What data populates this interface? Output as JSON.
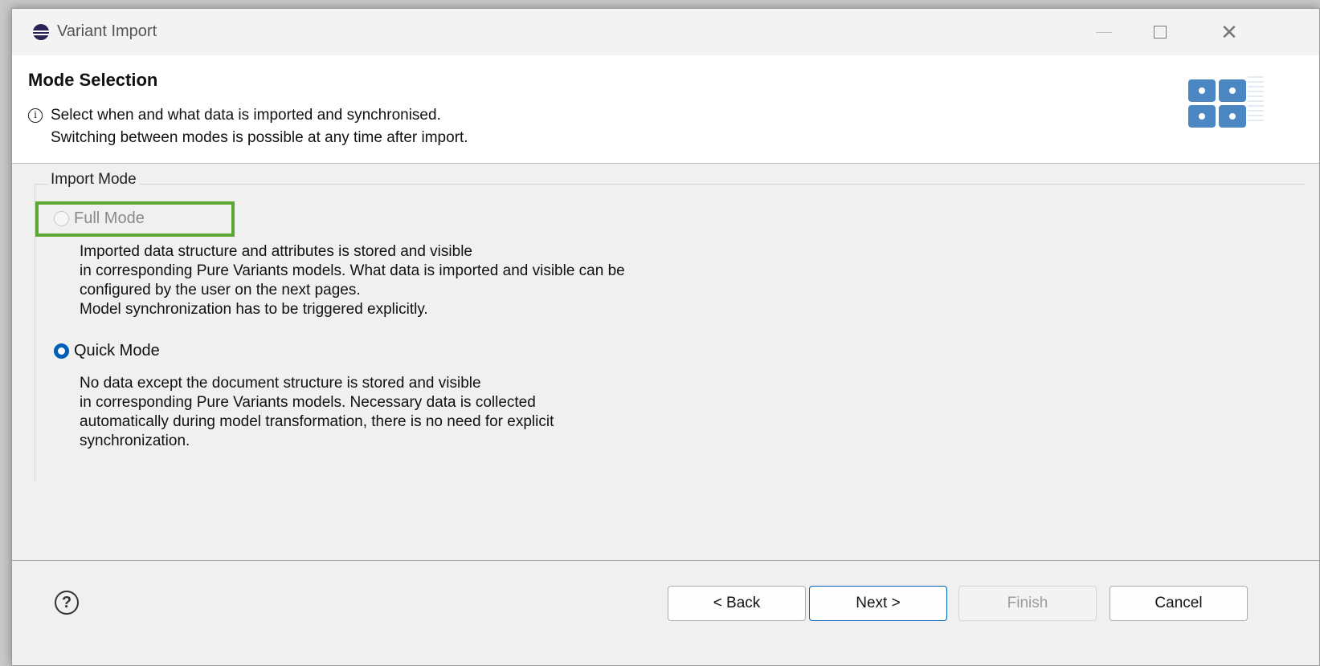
{
  "window": {
    "title": "Variant Import",
    "controls": {
      "minimize": "minimize-icon",
      "maximize": "maximize-icon",
      "close": "close-icon"
    }
  },
  "header": {
    "title": "Mode Selection",
    "message_line1": "Select when and what data is imported and synchronised.",
    "message_line2": "Switching between modes is possible at any time after import."
  },
  "import_mode": {
    "legend": "Import Mode",
    "options": [
      {
        "label": "Full Mode",
        "selected": false,
        "enabled": false,
        "description": [
          "Imported data structure and attributes is stored and visible",
          "in corresponding Pure Variants models. What data is imported and visible can be",
          "configured by the user on the next pages.",
          "Model synchronization has to be triggered explicitly."
        ]
      },
      {
        "label": "Quick Mode",
        "selected": true,
        "enabled": true,
        "description": [
          "No data except the document structure is stored and visible",
          "in corresponding Pure Variants models. Necessary data is collected",
          "automatically during model transformation, there is no need for explicit",
          "synchronization."
        ]
      }
    ]
  },
  "footer": {
    "help_icon": "?",
    "back_label": "< Back",
    "next_label": "Next >",
    "finish_label": "Finish",
    "cancel_label": "Cancel"
  },
  "colors": {
    "accent": "#005fb8",
    "highlight": "#5aa832",
    "banner_bg": "#ffffff",
    "dialog_bg": "#f0f0f0"
  }
}
